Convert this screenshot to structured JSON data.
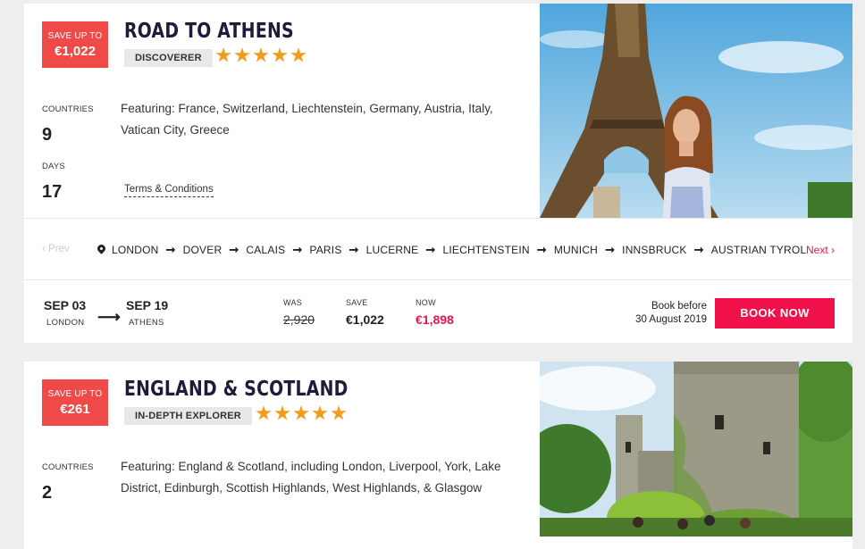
{
  "tours": [
    {
      "save_badge": {
        "line1": "SAVE UP TO",
        "amount": "€1,022"
      },
      "title": "ROAD TO ATHENS",
      "tier": "DISCOVERER",
      "rating": 5,
      "countries_label": "COUNTRIES",
      "countries_count": "9",
      "days_label": "DAYS",
      "days_count": "17",
      "featuring": "Featuring: France, Switzerland, Liechtenstein, Germany, Austria, Italy, Vatican City, Greece",
      "terms": "Terms & Conditions",
      "image_desc": "eiffel-tower-photo",
      "route": {
        "prev": "‹ Prev",
        "next": "Next ›",
        "stops": [
          "LONDON",
          "DOVER",
          "CALAIS",
          "PARIS",
          "LUCERNE",
          "LIECHTENSTEIN",
          "MUNICH",
          "INNSBRUCK",
          "AUSTRIAN TYROL"
        ]
      },
      "departure": {
        "start_date": "SEP 03",
        "start_city": "LONDON",
        "end_date": "SEP 19",
        "end_city": "ATHENS"
      },
      "pricing": {
        "was_label": "WAS",
        "was": "2,920",
        "save_label": "SAVE",
        "save": "€1,022",
        "now_label": "NOW",
        "now": "€1,898"
      },
      "book_before": {
        "line1": "Book before",
        "line2": "30 August 2019"
      },
      "book_button": "BOOK NOW"
    },
    {
      "save_badge": {
        "line1": "SAVE UP TO",
        "amount": "€261"
      },
      "title": "ENGLAND & SCOTLAND",
      "tier": "IN-DEPTH EXPLORER",
      "rating": 5,
      "countries_label": "COUNTRIES",
      "countries_count": "2",
      "featuring": "Featuring: England & Scotland, including London, Liverpool, York, Lake District, Edinburgh, Scottish Highlands, West Highlands, & Glasgow",
      "image_desc": "castle-photo"
    }
  ],
  "colors": {
    "accent": "#f0104a",
    "badge": "#ef4a48",
    "star": "#f49b1c",
    "title": "#1f1b3a"
  }
}
